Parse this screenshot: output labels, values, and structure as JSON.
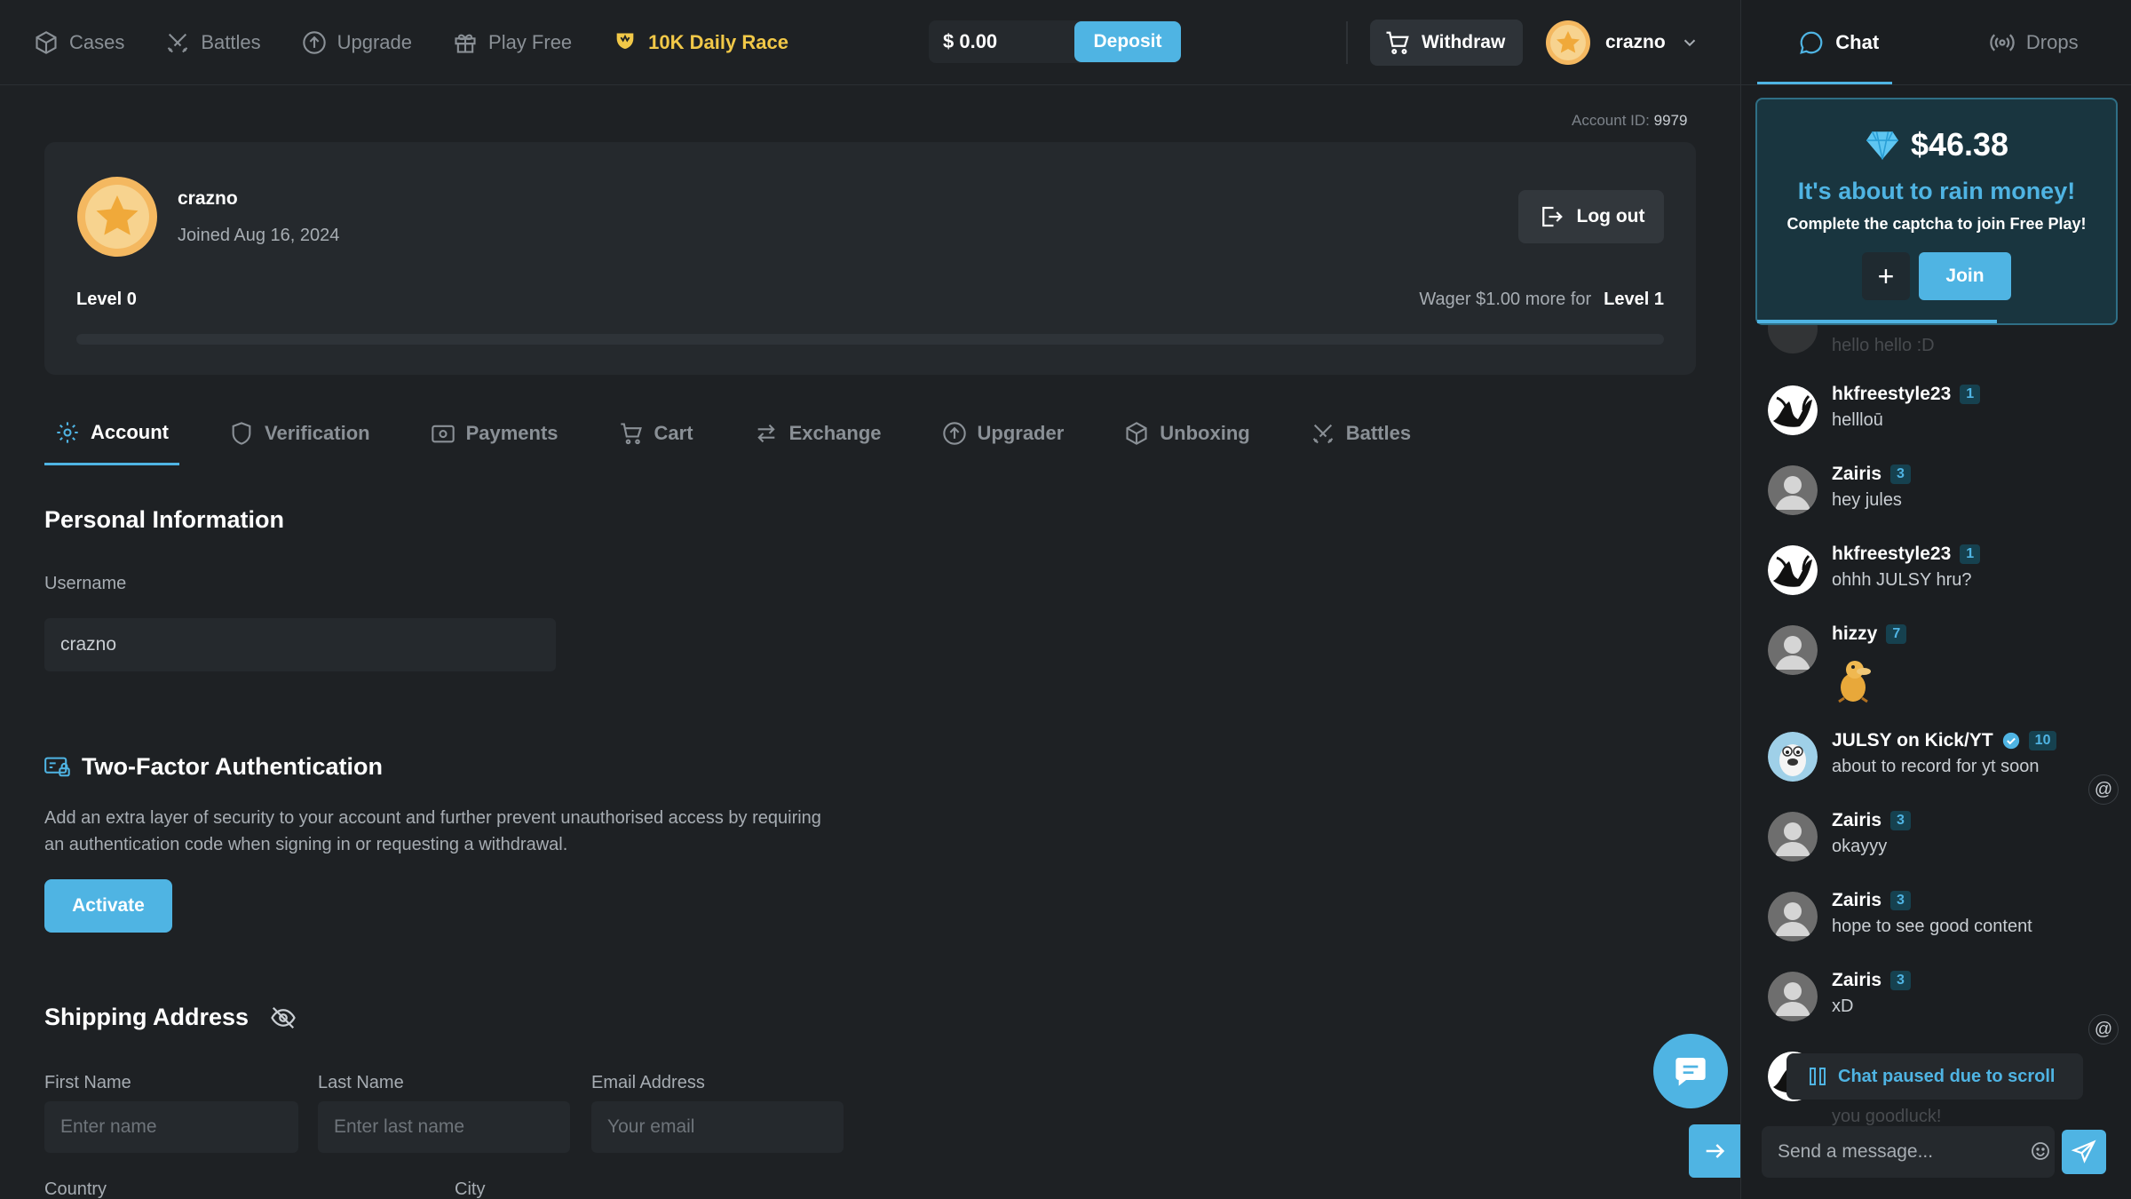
{
  "nav": {
    "items": [
      {
        "label": "Cases",
        "icon": "box-icon"
      },
      {
        "label": "Battles",
        "icon": "swords-icon"
      },
      {
        "label": "Upgrade",
        "icon": "arrow-up-circle-icon"
      },
      {
        "label": "Play Free",
        "icon": "gift-icon"
      },
      {
        "label": "10K Daily Race",
        "icon": "trophy-icon"
      }
    ],
    "balance": "$ 0.00",
    "deposit_label": "Deposit",
    "withdraw_label": "Withdraw",
    "username": "crazno"
  },
  "account": {
    "id_label": "Account ID:",
    "id_value": "9979",
    "username": "crazno",
    "joined": "Joined Aug 16, 2024",
    "logout_label": "Log out",
    "level_current": "Level 0",
    "wager_text": "Wager $1.00 more for",
    "level_next": "Level 1",
    "progress": 0
  },
  "tabs": [
    {
      "label": "Account",
      "icon": "gear-icon",
      "active": true
    },
    {
      "label": "Verification",
      "icon": "shield-icon"
    },
    {
      "label": "Payments",
      "icon": "wallet-icon"
    },
    {
      "label": "Cart",
      "icon": "cart-icon"
    },
    {
      "label": "Exchange",
      "icon": "exchange-icon"
    },
    {
      "label": "Upgrader",
      "icon": "arrow-up-circle-icon"
    },
    {
      "label": "Unboxing",
      "icon": "box-icon"
    },
    {
      "label": "Battles",
      "icon": "swords-icon"
    }
  ],
  "personal": {
    "title": "Personal Information",
    "username_label": "Username",
    "username_value": "crazno"
  },
  "twofa": {
    "title": "Two-Factor Authentication",
    "desc": "Add an extra layer of security to your account and further prevent unauthorised access by requiring an authentication code when signing in or requesting a withdrawal.",
    "activate_label": "Activate"
  },
  "shipping": {
    "title": "Shipping Address",
    "first_label": "First Name",
    "first_placeholder": "Enter name",
    "last_label": "Last Name",
    "last_placeholder": "Enter last name",
    "email_label": "Email Address",
    "email_placeholder": "Your email",
    "country_label": "Country",
    "city_label": "City"
  },
  "chat": {
    "tab_chat": "Chat",
    "tab_drops": "Drops",
    "rain": {
      "amount": "$46.38",
      "title": "It's about to rain money!",
      "subtitle": "Complete the captcha to join Free Play!",
      "plus": "+",
      "join_label": "Join"
    },
    "partial_top_text": "hello hello :D",
    "messages": [
      {
        "name": "hkfreestyle23",
        "level": "1",
        "text": "hellloū",
        "avatar": "bw"
      },
      {
        "name": "Zairis",
        "level": "3",
        "text": "hey jules",
        "avatar": "default"
      },
      {
        "name": "hkfreestyle23",
        "level": "1",
        "text": "ohhh JULSY hru?",
        "avatar": "bw"
      },
      {
        "name": "hizzy",
        "level": "7",
        "text": "",
        "avatar": "default"
      },
      {
        "name": "JULSY on Kick/YT",
        "level": "10",
        "text": "about to record for yt soon",
        "avatar": "julsy"
      },
      {
        "name": "Zairis",
        "level": "3",
        "text": "okayyy",
        "avatar": "default"
      },
      {
        "name": "Zairis",
        "level": "3",
        "text": "hope to see good content",
        "avatar": "default"
      },
      {
        "name": "Zairis",
        "level": "3",
        "text": "xD",
        "avatar": "default"
      }
    ],
    "partial_bottom_text": "you goodluck!",
    "paused_label": "Chat paused due to scroll",
    "input_placeholder": "Send a message...",
    "at_symbol": "@"
  }
}
